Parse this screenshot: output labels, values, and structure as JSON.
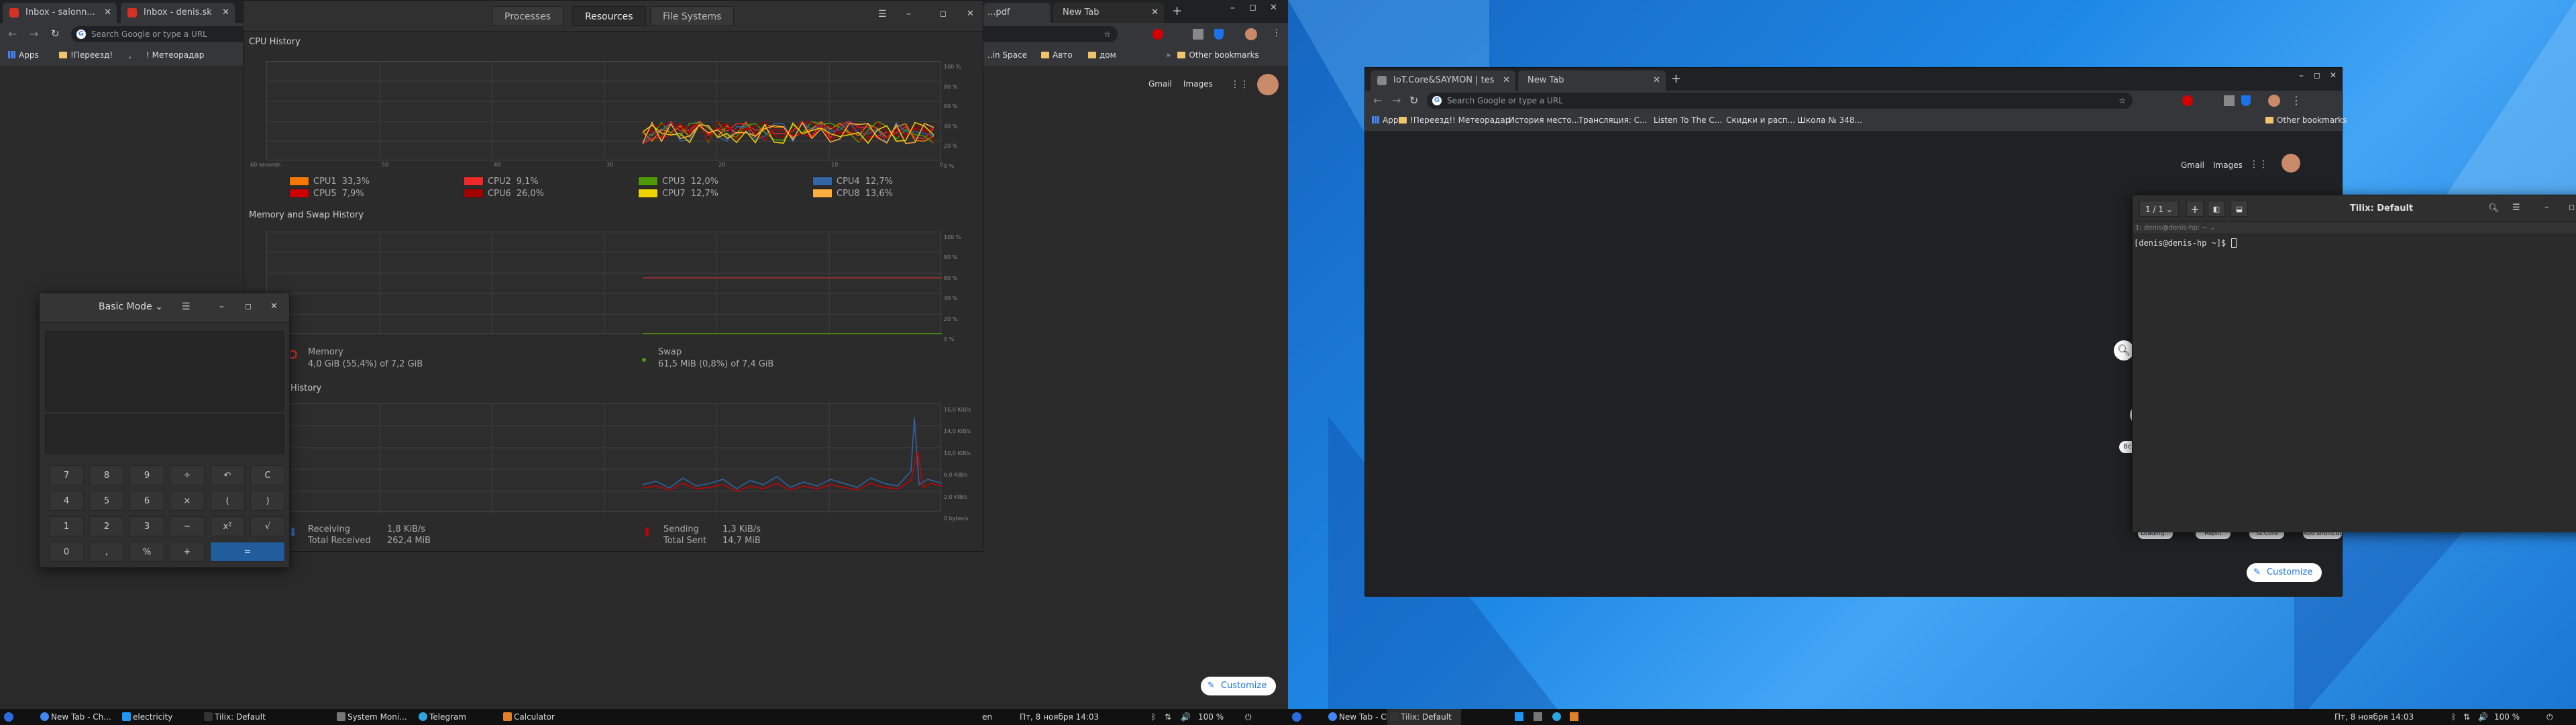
{
  "left": {
    "chrome": {
      "tabs": [
        {
          "label": "Inbox - salonn..."
        },
        {
          "label": "Inbox - denis.sk"
        },
        {
          "label": "...pdf"
        },
        {
          "label": "New Tab"
        }
      ],
      "omnibox_placeholder": "Search Google or type a URL",
      "bookmarks": [
        "Apps",
        "!Переезд!",
        ",",
        "! Метеорадар",
        "..in Space",
        "Авто",
        "дом",
        "Other bookmarks"
      ],
      "gmail": "Gmail",
      "images": "Images",
      "customize": "Customize"
    },
    "sysmon": {
      "tabs": [
        "Processes",
        "Resources",
        "File Systems"
      ],
      "cpu_title": "CPU History",
      "cpu_y_ticks": [
        "100 %",
        "80 %",
        "60 %",
        "40 %",
        "20 %",
        "0 %"
      ],
      "cpu_x_ticks": [
        "60 seconds",
        "50",
        "40",
        "30",
        "20",
        "10",
        "0"
      ],
      "cpu_legend": [
        {
          "label": "CPU1",
          "value": "33,3%",
          "color": "#f57900"
        },
        {
          "label": "CPU2",
          "value": "9,1%",
          "color": "#ef2929"
        },
        {
          "label": "CPU3",
          "value": "12,0%",
          "color": "#4e9a06"
        },
        {
          "label": "CPU4",
          "value": "12,7%",
          "color": "#3465a4"
        },
        {
          "label": "CPU5",
          "value": "7,9%",
          "color": "#cc0000"
        },
        {
          "label": "CPU6",
          "value": "26,0%",
          "color": "#a40000"
        },
        {
          "label": "CPU7",
          "value": "12,7%",
          "color": "#edd400"
        },
        {
          "label": "CPU8",
          "value": "13,6%",
          "color": "#fcaf3e"
        }
      ],
      "mem_title": "Memory and Swap History",
      "mem_y_ticks": [
        "100 %",
        "80 %",
        "60 %",
        "40 %",
        "20 %",
        "0 %"
      ],
      "memory_label": "Memory",
      "memory_value": "4,0 GiB (55,4%) of 7,2 GiB",
      "swap_label": "Swap",
      "swap_value": "61,5 MiB (0,8%) of 7,4 GiB",
      "net_title": "History",
      "net_y_ticks": [
        "16,0 KiB/s",
        "14,0 KiB/s",
        "10,0 KiB/s",
        "6,0 KiB/s",
        "2,0 KiB/s",
        "0 bytes/s"
      ],
      "receiving_label": "Receiving",
      "receiving_value": "1,8 KiB/s",
      "total_received_label": "Total Received",
      "total_received_value": "262,4 MiB",
      "sending_label": "Sending",
      "sending_value": "1,3 KiB/s",
      "total_sent_label": "Total Sent",
      "total_sent_value": "14,7 MiB"
    },
    "calculator": {
      "mode": "Basic Mode",
      "keys": [
        "7",
        "8",
        "9",
        "÷",
        "↶",
        "C",
        "4",
        "5",
        "6",
        "×",
        "(",
        ")",
        "1",
        "2",
        "3",
        "−",
        "x²",
        "√",
        "0",
        ",",
        "%",
        "+",
        "="
      ]
    },
    "taskbar": {
      "items": [
        "New Tab - Ch...",
        "electricity",
        "Tilix: Default",
        "System Moni...",
        "Telegram",
        "Calculator"
      ],
      "lang": "en",
      "clock": "Пт, 8 ноября  14:03",
      "volume": "100 %"
    }
  },
  "right": {
    "chrome": {
      "tabs": [
        {
          "label": "IoT.Core&SAYMON | tes"
        },
        {
          "label": "New Tab"
        }
      ],
      "omnibox_placeholder": "Search Google or type a URL",
      "bookmarks": [
        "Apps",
        "!Переезд!",
        ",",
        "! Метеорадар",
        "История место...",
        "Трансляция: С...",
        "Listen To The C...",
        "Скидки и расп...",
        "Школа № 348...",
        "Other bookmarks"
      ],
      "gmail": "Gmail",
      "images": "Images",
      "shortcuts": [
        "Loading...",
        "Replit",
        "Ya.Core",
        "Add shortcut"
      ],
      "customize": "Customize",
      "hint": "Все и"
    },
    "tilix": {
      "title": "Tilix: Default",
      "session": "1 / 1",
      "tab_title": "1: denis@denis-hp: ~",
      "prompt": "[denis@denis-hp ~]$ "
    },
    "taskbar": {
      "items": [
        "New Tab - Ch...",
        "Tilix: Default"
      ],
      "clock": "Пт, 8 ноября  14:03",
      "volume": "100 %"
    }
  }
}
